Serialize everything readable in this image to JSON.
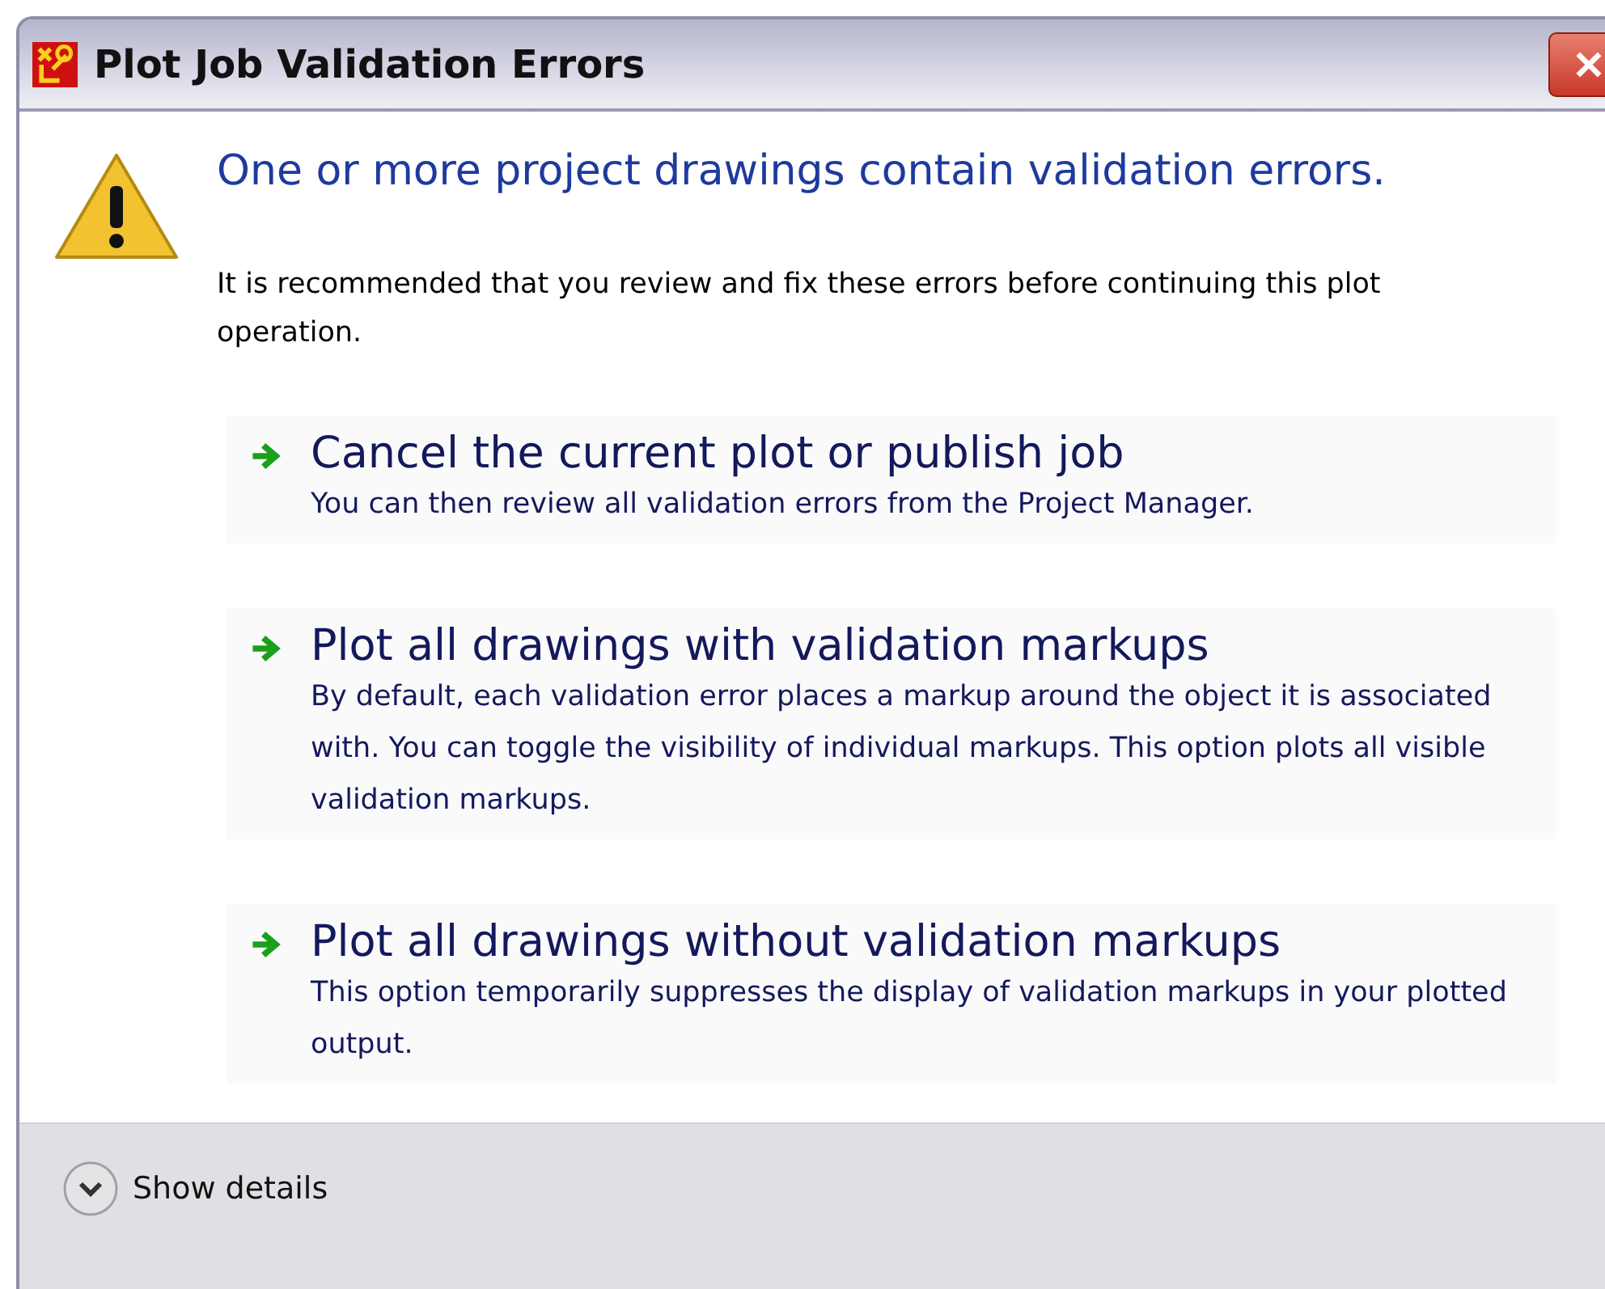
{
  "window": {
    "title": "Plot Job Validation Errors"
  },
  "main_instruction": "One or more project drawings contain validation errors.",
  "content": "It is recommended that you review and fix these errors before continuing this plot operation.",
  "options": [
    {
      "title": "Cancel the current plot or publish job",
      "description": "You can then review all validation errors from the Project Manager."
    },
    {
      "title": "Plot all drawings with validation markups",
      "description": "By default, each validation error places a markup around the object it is associated with.  You can toggle the visibility of individual markups. This option plots all visible validation markups."
    },
    {
      "title": "Plot all drawings without validation markups",
      "description": "This option temporarily suppresses the display of validation markups in your plotted output."
    }
  ],
  "footer": {
    "expander_label": "Show details",
    "expanded": false
  }
}
